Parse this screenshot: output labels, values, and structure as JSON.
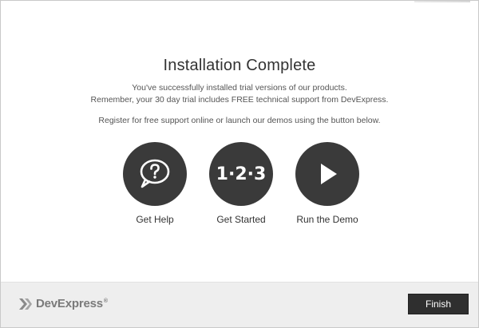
{
  "page": {
    "title": "Installation Complete",
    "description_line1": "You've successfully installed trial versions of our products.",
    "description_line2": "Remember, your 30 day trial includes FREE technical support from DevExpress.",
    "description_line3": "Register for free support online or launch our demos using the button below."
  },
  "actions": [
    {
      "label": "Get Help",
      "icon": "speech-bubble-question-icon"
    },
    {
      "label": "Get Started",
      "icon": "numbers-123-icon",
      "icon_text": "1·2·3"
    },
    {
      "label": "Run the Demo",
      "icon": "play-icon"
    }
  ],
  "footer": {
    "logo_text": "DevExpress",
    "logo_reg": "®",
    "finish_label": "Finish"
  },
  "colors": {
    "circle": "#3a3a3a",
    "footer_bg": "#eeeeee",
    "button_bg": "#2f2f2f"
  }
}
